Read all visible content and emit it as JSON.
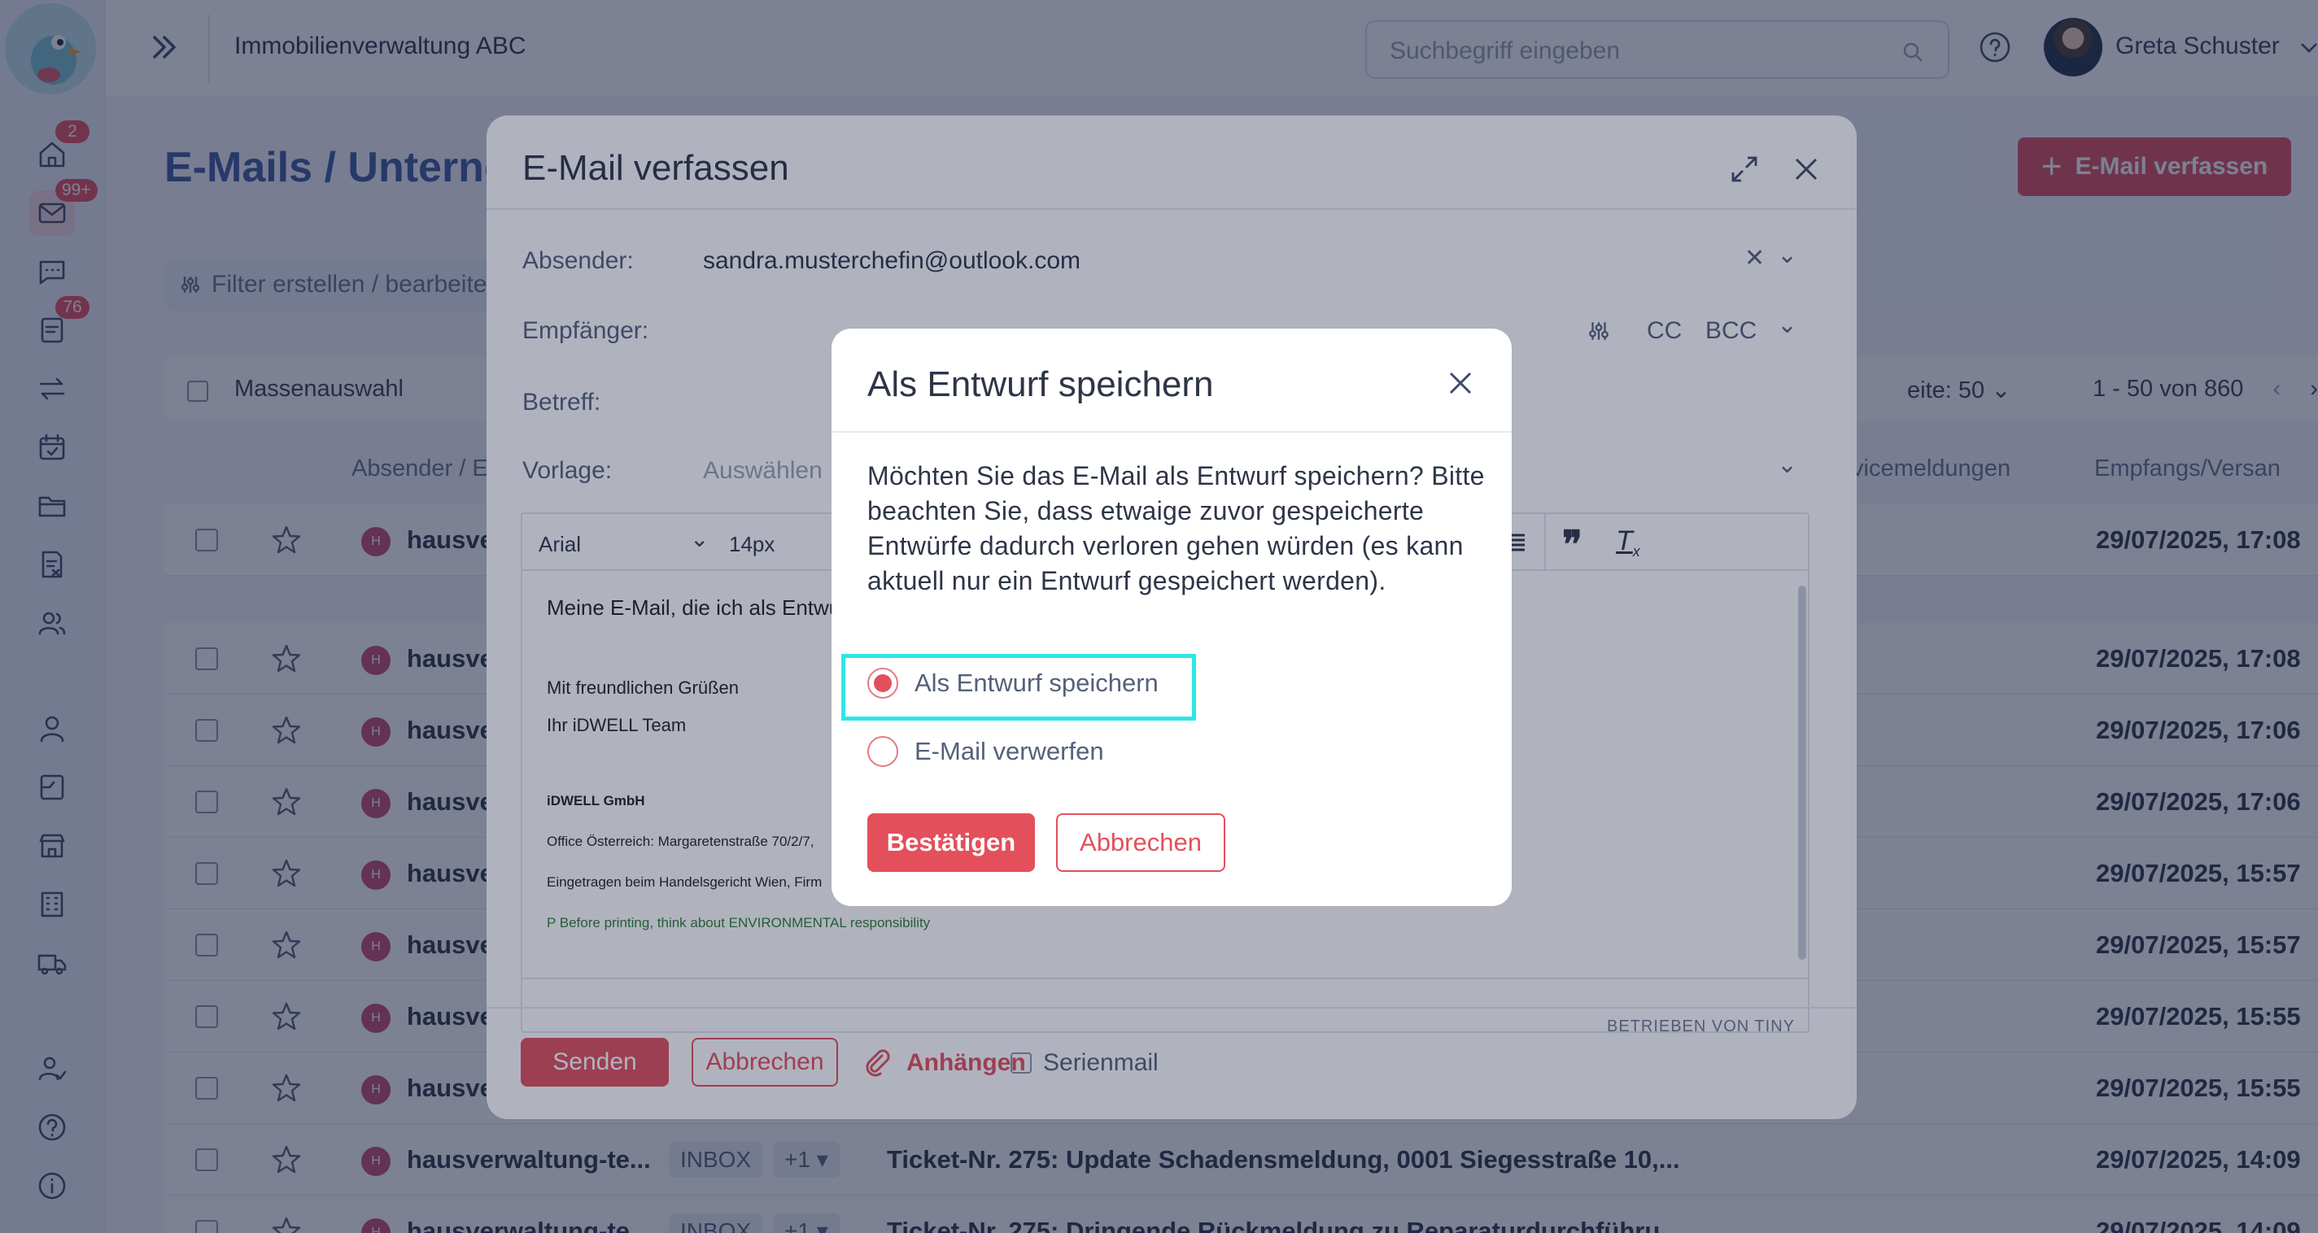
{
  "topbar": {
    "company": "Immobilienverwaltung ABC",
    "search_placeholder": "Suchbegriff eingeben",
    "user_name": "Greta Schuster"
  },
  "sidebar": {
    "badges": {
      "home": "2",
      "mail": "99+",
      "tasks": "76"
    }
  },
  "page": {
    "title": "E-Mails / Unterne",
    "compose_button": "E-Mail verfassen",
    "filter_label": "Filter erstellen / bearbeite",
    "mass_select": "Massenauswahl",
    "per_page_label": "eite:",
    "per_page_value": "50",
    "pagination": "1 - 50 von 860",
    "columns": {
      "sender": "Absender / E",
      "service": "vicemeldungen",
      "date": "Empfangs/Versan"
    }
  },
  "rows": [
    {
      "sender": "hausve",
      "tag": "",
      "tag2": "",
      "subject": "",
      "date": "29/07/2025, 17:08"
    },
    {
      "sender": "hausve",
      "tag": "",
      "tag2": "",
      "subject": "",
      "date": "29/07/2025, 17:08"
    },
    {
      "sender": "hausve",
      "tag": "",
      "tag2": "",
      "subject": "",
      "date": "29/07/2025, 17:06"
    },
    {
      "sender": "hausve",
      "tag": "",
      "tag2": "",
      "subject": "",
      "date": "29/07/2025, 17:06"
    },
    {
      "sender": "hausve",
      "tag": "",
      "tag2": "",
      "subject": "",
      "date": "29/07/2025, 15:57"
    },
    {
      "sender": "hausve",
      "tag": "",
      "tag2": "",
      "subject": "",
      "date": "29/07/2025, 15:57"
    },
    {
      "sender": "hausve",
      "tag": "",
      "tag2": "",
      "subject": "",
      "date": "29/07/2025, 15:55"
    },
    {
      "sender": "hausve",
      "tag": "",
      "tag2": "",
      "subject": "",
      "date": "29/07/2025, 15:55"
    },
    {
      "sender": "hausverwaltung-te...",
      "tag": "INBOX",
      "tag2": "+1 ▾",
      "subject": "Ticket-Nr. 275: Update Schadensmeldung, 0001 Siegesstraße 10,...",
      "date": "29/07/2025, 14:09"
    },
    {
      "sender": "hausverwaltung-te...",
      "tag": "INBOX",
      "tag2": "+1 ▾",
      "subject": "Ticket-Nr. 275: Dringende Rückmeldung zu Reparaturdurchführu...",
      "date": "29/07/2025, 14:09"
    }
  ],
  "compose": {
    "title": "E-Mail verfassen",
    "sender_label": "Absender:",
    "sender_value": "sandra.musterchefin@outlook.com",
    "recipient_label": "Empfänger:",
    "cc": "CC",
    "bcc": "BCC",
    "subject_label": "Betreff:",
    "template_label": "Vorlage:",
    "template_placeholder": "Auswählen",
    "font": "Arial",
    "font_size": "14px",
    "body": {
      "line1": "Meine E-Mail, die ich als Entwu",
      "greeting": "Mit freundlichen Grüßen",
      "team": "Ihr iDWELL Team",
      "company": "iDWELL GmbH",
      "office": "Office Österreich: Margaretenstraße 70/2/7,",
      "register": "Eingetragen beim Handelsgericht Wien, Firm",
      "env": "P Before printing, think about ENVIRONMENTAL responsibility"
    },
    "powered_by": "BETRIEBEN VON TINY",
    "send": "Senden",
    "cancel": "Abbrechen",
    "attach": "Anhängen",
    "serial": "Serienmail"
  },
  "draft_dialog": {
    "title": "Als Entwurf speichern",
    "message": "Möchten Sie das E-Mail als Entwurf speichern? Bitte beachten Sie, dass etwaige zuvor gespeicherte Entwürfe dadurch verloren gehen würden (es kann aktuell nur ein Entwurf gespeichert werden).",
    "option_save": "Als Entwurf speichern",
    "option_discard": "E-Mail verwerfen",
    "selected_option": "Als Entwurf speichern",
    "confirm": "Bestätigen",
    "cancel": "Abbrechen"
  },
  "colors": {
    "accent": "#e3505b",
    "highlight": "#2ee6e6",
    "overlay": "#162040"
  }
}
